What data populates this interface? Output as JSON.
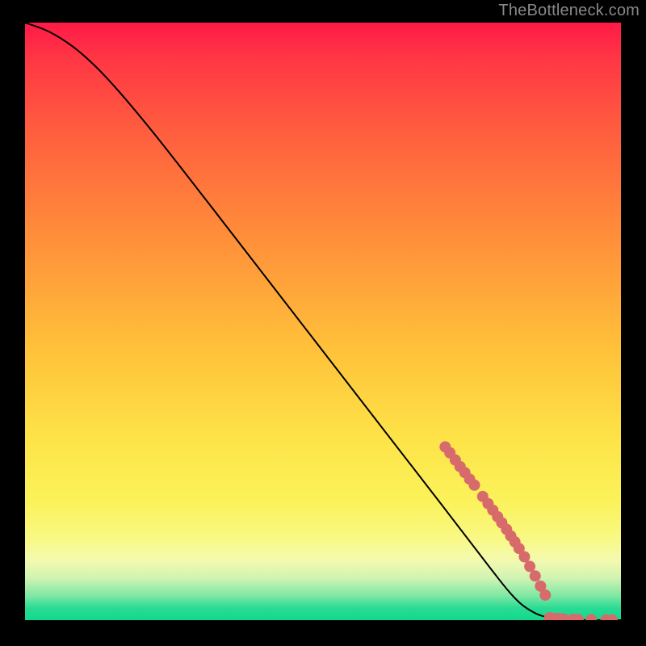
{
  "attribution": "TheBottleneck.com",
  "colors": {
    "background": "#000000",
    "marker": "#d76a6a",
    "curve": "#000000"
  },
  "chart_data": {
    "type": "line",
    "title": "",
    "xlabel": "",
    "ylabel": "",
    "xlim": [
      0,
      100
    ],
    "ylim": [
      0,
      100
    ],
    "curve": [
      {
        "x": 0.0,
        "y": 100.0
      },
      {
        "x": 4.0,
        "y": 98.5
      },
      {
        "x": 8.0,
        "y": 96.0
      },
      {
        "x": 12.0,
        "y": 92.5
      },
      {
        "x": 16.0,
        "y": 88.2
      },
      {
        "x": 22.0,
        "y": 81.0
      },
      {
        "x": 30.0,
        "y": 70.8
      },
      {
        "x": 40.0,
        "y": 57.9
      },
      {
        "x": 50.0,
        "y": 45.0
      },
      {
        "x": 60.0,
        "y": 32.1
      },
      {
        "x": 70.0,
        "y": 19.2
      },
      {
        "x": 78.0,
        "y": 8.8
      },
      {
        "x": 82.0,
        "y": 3.9
      },
      {
        "x": 85.0,
        "y": 1.5
      },
      {
        "x": 88.0,
        "y": 0.4
      },
      {
        "x": 92.0,
        "y": 0.05
      },
      {
        "x": 100.0,
        "y": 0.0
      }
    ],
    "markers": [
      {
        "x": 70.5,
        "y": 29.0
      },
      {
        "x": 71.3,
        "y": 28.0
      },
      {
        "x": 72.2,
        "y": 26.8
      },
      {
        "x": 73.0,
        "y": 25.7
      },
      {
        "x": 73.8,
        "y": 24.7
      },
      {
        "x": 74.6,
        "y": 23.6
      },
      {
        "x": 75.4,
        "y": 22.6
      },
      {
        "x": 76.8,
        "y": 20.7
      },
      {
        "x": 77.7,
        "y": 19.5
      },
      {
        "x": 78.5,
        "y": 18.4
      },
      {
        "x": 79.3,
        "y": 17.3
      },
      {
        "x": 80.0,
        "y": 16.3
      },
      {
        "x": 80.8,
        "y": 15.2
      },
      {
        "x": 81.5,
        "y": 14.1
      },
      {
        "x": 82.2,
        "y": 13.1
      },
      {
        "x": 82.9,
        "y": 12.0
      },
      {
        "x": 83.8,
        "y": 10.6
      },
      {
        "x": 84.7,
        "y": 9.0
      },
      {
        "x": 85.6,
        "y": 7.4
      },
      {
        "x": 86.5,
        "y": 5.7
      },
      {
        "x": 87.3,
        "y": 4.2
      },
      {
        "x": 88.0,
        "y": 0.4
      },
      {
        "x": 88.8,
        "y": 0.3
      },
      {
        "x": 89.6,
        "y": 0.25
      },
      {
        "x": 90.4,
        "y": 0.2
      },
      {
        "x": 92.0,
        "y": 0.15
      },
      {
        "x": 92.8,
        "y": 0.12
      },
      {
        "x": 95.0,
        "y": 0.08
      },
      {
        "x": 97.5,
        "y": 0.04
      },
      {
        "x": 98.5,
        "y": 0.03
      }
    ]
  }
}
